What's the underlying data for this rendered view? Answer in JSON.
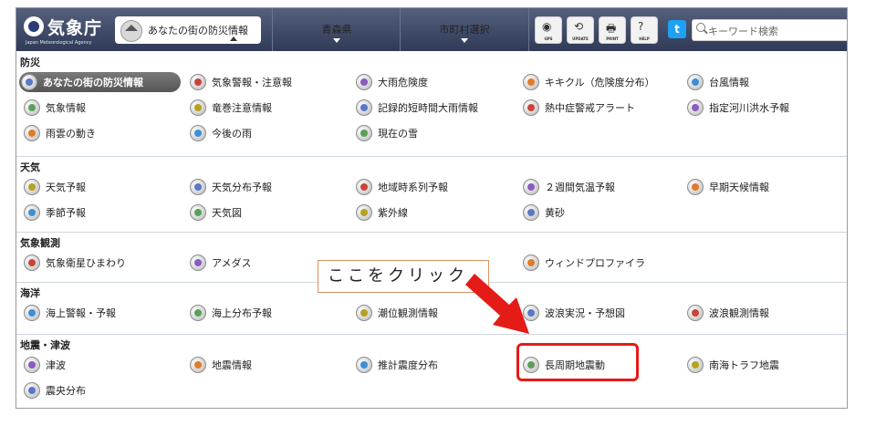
{
  "header": {
    "logo_text": "気象庁",
    "logo_sub": "Japan Meteorological Agency",
    "home_tab": "あなたの街の防災情報",
    "prefecture": "青森県",
    "city": "市町村選択",
    "tools": [
      {
        "glyph": "◉",
        "label": "GPS"
      },
      {
        "glyph": "⟲",
        "label": "UPDATE"
      },
      {
        "glyph": "🖶",
        "label": "PRINT"
      },
      {
        "glyph": "?",
        "label": "HELP"
      }
    ],
    "twitter": "t",
    "search_placeholder": "キーワード検索"
  },
  "sections": [
    {
      "title": "防災",
      "rows": [
        [
          "あなたの街の防災情報",
          "気象警報・注意報",
          "大雨危険度",
          "キキクル（危険度分布）",
          "台風情報"
        ],
        [
          "気象情報",
          "竜巻注意情報",
          "記録的短時間大雨情報",
          "熱中症警戒アラート",
          "指定河川洪水予報"
        ],
        [
          "雨雲の動き",
          "今後の雨",
          "現在の雪"
        ]
      ]
    },
    {
      "title": "天気",
      "rows": [
        [
          "天気予報",
          "天気分布予報",
          "地域時系列予報",
          "２週間気温予報",
          "早期天候情報"
        ],
        [
          "季節予報",
          "天気図",
          "紫外線",
          "黄砂"
        ]
      ]
    },
    {
      "title": "気象観測",
      "rows": [
        [
          "気象衛星ひまわり",
          "アメダス",
          "",
          "ウィンドプロファイラ"
        ]
      ]
    },
    {
      "title": "海洋",
      "rows": [
        [
          "海上警報・予報",
          "海上分布予報",
          "潮位観測情報",
          "波浪実況・予想図",
          "波浪観測情報"
        ]
      ]
    },
    {
      "title": "地震・津波",
      "rows": [
        [
          "津波",
          "地震情報",
          "推計震度分布",
          "長周期地震動",
          "南海トラフ地震"
        ],
        [
          "震央分布"
        ]
      ]
    }
  ],
  "icon_colors": [
    "#5a78c8",
    "#c8453a",
    "#8a5bc0",
    "#e07b2a",
    "#3d8fd6",
    "#5aa05a",
    "#b8a020"
  ],
  "annotation": {
    "callout": "ここをクリック",
    "highlight_color": "#e41b17"
  }
}
